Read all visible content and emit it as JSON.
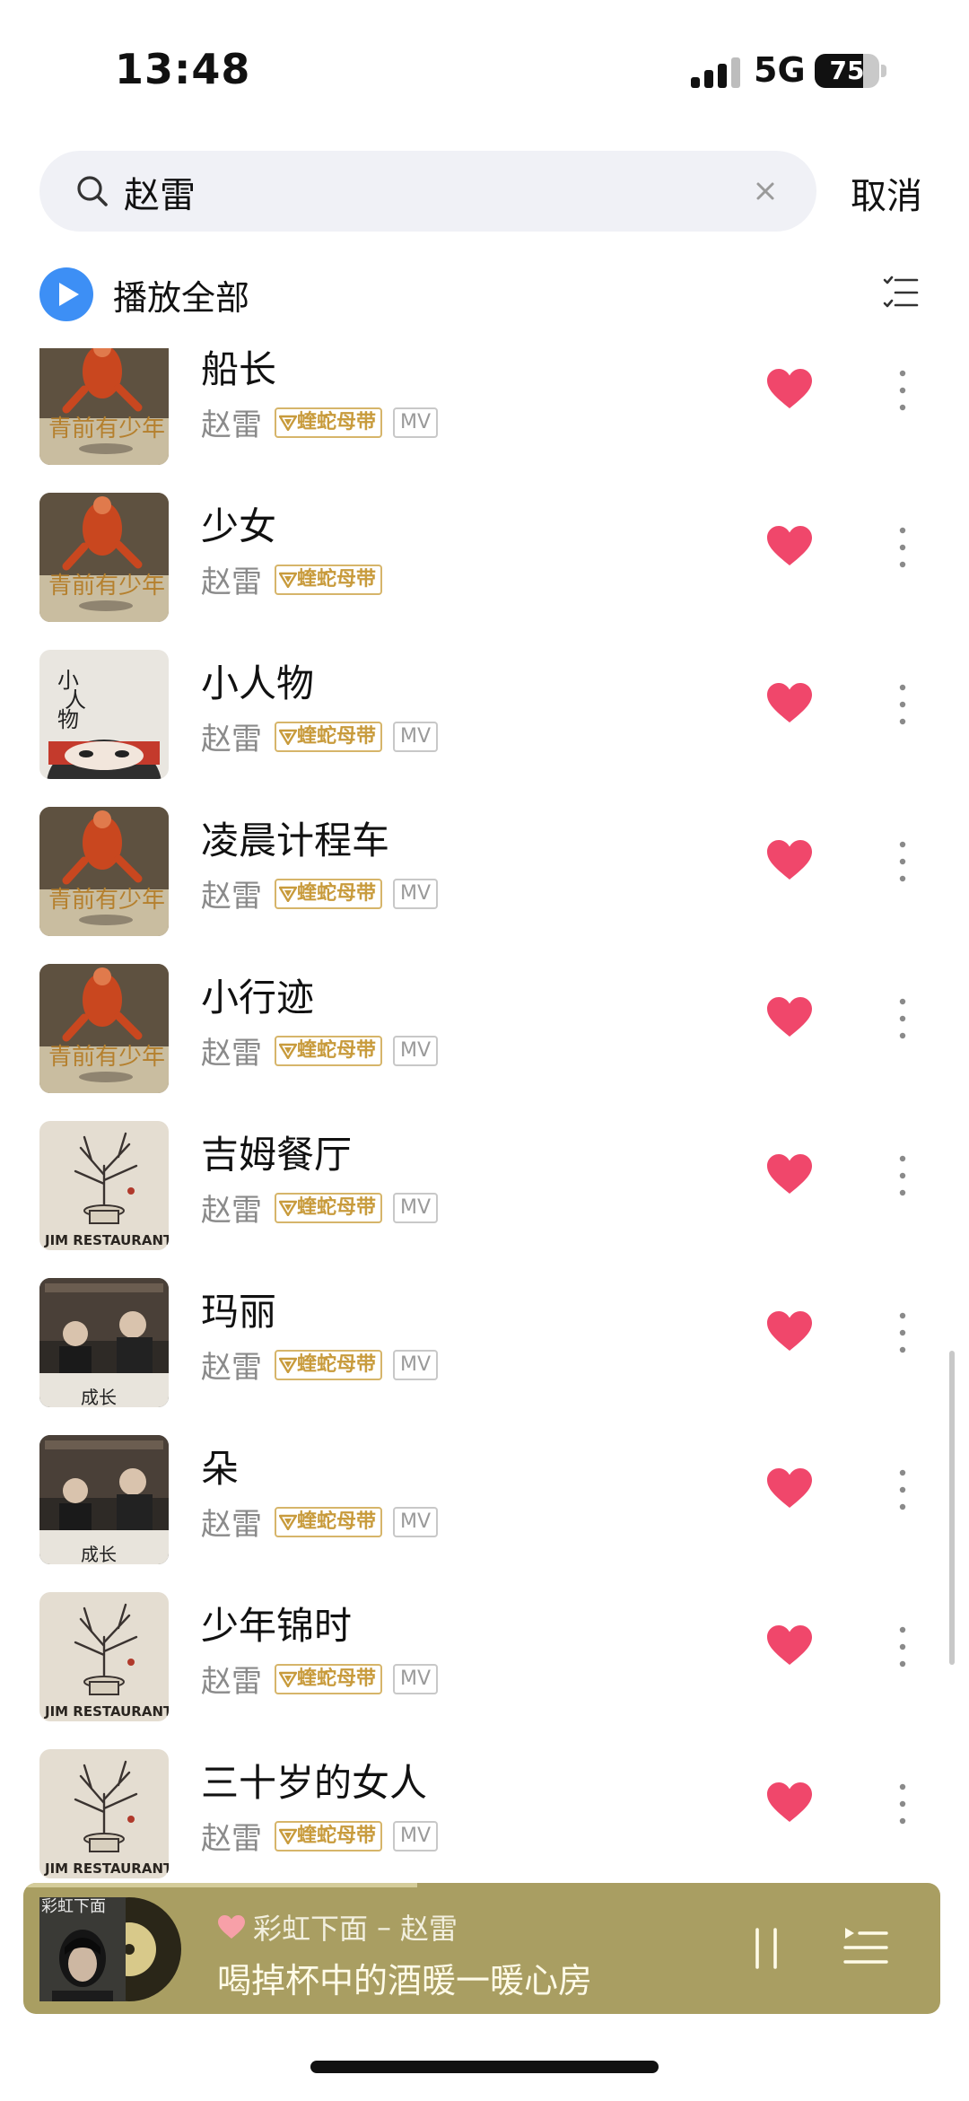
{
  "status_bar": {
    "time": "13:48",
    "network": "5G",
    "battery": "75"
  },
  "search": {
    "query": "赵雷",
    "cancel_label": "取消"
  },
  "play_all_label": "播放全部",
  "badge_label": "蝰蛇母带",
  "mv_label": "MV",
  "songs": [
    {
      "title": "船长",
      "artist": "赵雷",
      "has_mv": true,
      "cover": "youth-jump"
    },
    {
      "title": "少女",
      "artist": "赵雷",
      "has_mv": false,
      "cover": "youth-jump"
    },
    {
      "title": "小人物",
      "artist": "赵雷",
      "has_mv": true,
      "cover": "xiao-ren-wu"
    },
    {
      "title": "凌晨计程车",
      "artist": "赵雷",
      "has_mv": true,
      "cover": "youth-jump"
    },
    {
      "title": "小行迹",
      "artist": "赵雷",
      "has_mv": true,
      "cover": "youth-jump"
    },
    {
      "title": "吉姆餐厅",
      "artist": "赵雷",
      "has_mv": true,
      "cover": "jim-restaurant"
    },
    {
      "title": "玛丽",
      "artist": "赵雷",
      "has_mv": true,
      "cover": "grow-up"
    },
    {
      "title": "朵",
      "artist": "赵雷",
      "has_mv": true,
      "cover": "grow-up"
    },
    {
      "title": "少年锦时",
      "artist": "赵雷",
      "has_mv": true,
      "cover": "jim-restaurant"
    },
    {
      "title": "三十岁的女人",
      "artist": "赵雷",
      "has_mv": true,
      "cover": "jim-restaurant"
    }
  ],
  "player": {
    "song": "彩虹下面",
    "separator": "–",
    "artist": "赵雷",
    "lyric": "喝掉杯中的酒暖一暖心房",
    "progress_fraction": 0.43
  },
  "colors": {
    "accent_blue": "#3d8ff5",
    "heart": "#f0476b",
    "player_bg": "#a99e62",
    "badge_gold": "#c89b3c"
  }
}
